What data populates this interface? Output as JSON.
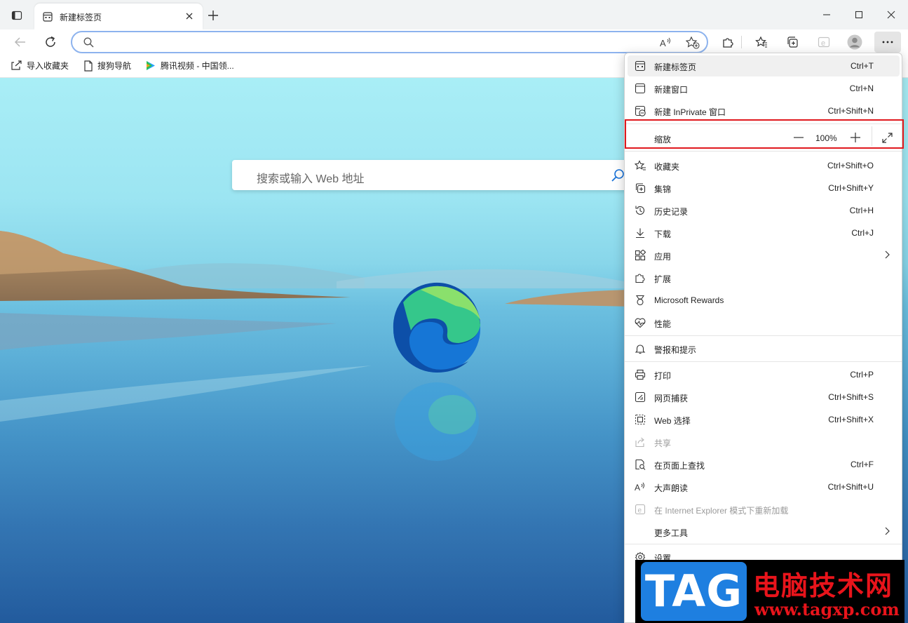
{
  "tab": {
    "title": "新建标签页"
  },
  "favorites": [
    {
      "label": "导入收藏夹",
      "icon": "import-favorites-icon"
    },
    {
      "label": "搜狗导航",
      "icon": "page-icon"
    },
    {
      "label": "腾讯视频 - 中国领...",
      "icon": "tencent-video-icon"
    }
  ],
  "search": {
    "placeholder": "搜索或输入 Web 地址"
  },
  "menu": {
    "items_top": [
      {
        "label": "新建标签页",
        "shortcut": "Ctrl+T",
        "icon": "new-tab-icon"
      },
      {
        "label": "新建窗口",
        "shortcut": "Ctrl+N",
        "icon": "new-window-icon"
      },
      {
        "label": "新建 InPrivate 窗口",
        "shortcut": "Ctrl+Shift+N",
        "icon": "inprivate-icon"
      }
    ],
    "zoom": {
      "label": "缩放",
      "value": "100%"
    },
    "items_mid": [
      {
        "label": "收藏夹",
        "shortcut": "Ctrl+Shift+O",
        "icon": "favorites-icon"
      },
      {
        "label": "集锦",
        "shortcut": "Ctrl+Shift+Y",
        "icon": "collections-icon"
      },
      {
        "label": "历史记录",
        "shortcut": "Ctrl+H",
        "icon": "history-icon"
      },
      {
        "label": "下载",
        "shortcut": "Ctrl+J",
        "icon": "download-icon"
      },
      {
        "label": "应用",
        "shortcut": "",
        "icon": "apps-icon"
      },
      {
        "label": "扩展",
        "shortcut": "",
        "icon": "extensions-icon"
      },
      {
        "label": "Microsoft Rewards",
        "shortcut": "",
        "icon": "rewards-icon"
      },
      {
        "label": "性能",
        "shortcut": "",
        "icon": "performance-icon"
      }
    ],
    "alerts": {
      "label": "警报和提示",
      "icon": "bell-icon"
    },
    "items_tools": [
      {
        "label": "打印",
        "shortcut": "Ctrl+P",
        "icon": "print-icon"
      },
      {
        "label": "网页捕获",
        "shortcut": "Ctrl+Shift+S",
        "icon": "web-capture-icon"
      },
      {
        "label": "Web 选择",
        "shortcut": "Ctrl+Shift+X",
        "icon": "web-select-icon"
      },
      {
        "label": "共享",
        "shortcut": "",
        "icon": "share-icon"
      },
      {
        "label": "在页面上查找",
        "shortcut": "Ctrl+F",
        "icon": "find-icon"
      },
      {
        "label": "大声朗读",
        "shortcut": "Ctrl+Shift+U",
        "icon": "read-aloud-icon"
      },
      {
        "label": "在 Internet Explorer 模式下重新加载",
        "shortcut": "",
        "icon": "ie-mode-icon"
      },
      {
        "label": "更多工具",
        "shortcut": "",
        "icon": "more-tools-icon"
      }
    ],
    "settings": {
      "label": "设置",
      "icon": "settings-icon"
    }
  },
  "watermark": {
    "tag": "TAG",
    "title": "电脑技术网",
    "url": "www.tagxp.com"
  }
}
